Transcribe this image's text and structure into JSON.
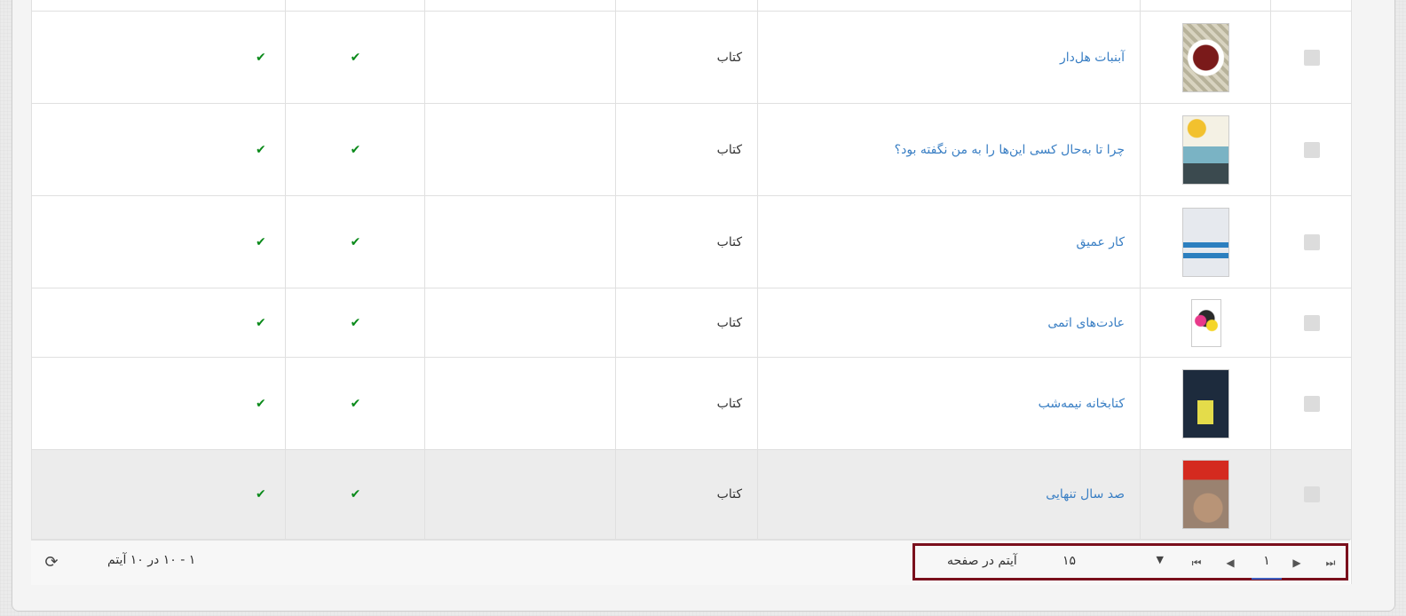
{
  "rows": [
    {
      "name": "آبنبات هل‌دار",
      "type": "کتاب",
      "check1": "✔",
      "check2": "✔",
      "cover": "cover-abnabat"
    },
    {
      "name": "چرا تا به‌حال کسی این‌ها را به من نگفته بود؟",
      "type": "کتاب",
      "check1": "✔",
      "check2": "✔",
      "cover": "cover-chera"
    },
    {
      "name": "کار عمیق",
      "type": "کتاب",
      "check1": "✔",
      "check2": "✔",
      "cover": "cover-kar-amigh"
    },
    {
      "name": "عادت‌های اتمی",
      "type": "کتاب",
      "check1": "✔",
      "check2": "✔",
      "cover": "cover-adat"
    },
    {
      "name": "کتابخانه نیمه‌شب",
      "type": "کتاب",
      "check1": "✔",
      "check2": "✔",
      "cover": "cover-ketabkhane"
    },
    {
      "name": "صد سال تنهایی",
      "type": "کتاب",
      "check1": "✔",
      "check2": "✔",
      "cover": "cover-sad-sal"
    }
  ],
  "footer": {
    "range_text": "۱ - ۱۰ در ۱۰ آیتم",
    "per_page_label": "آیتم در صفحه",
    "per_page_value": "۱۵",
    "current_page": "۱",
    "refresh_icon": "refresh-icon"
  },
  "colors": {
    "link": "#3a7fc4",
    "check": "#0a8a1a",
    "pager_highlight": "#7a0f1c",
    "active_page_underline": "#3f5fbf"
  }
}
